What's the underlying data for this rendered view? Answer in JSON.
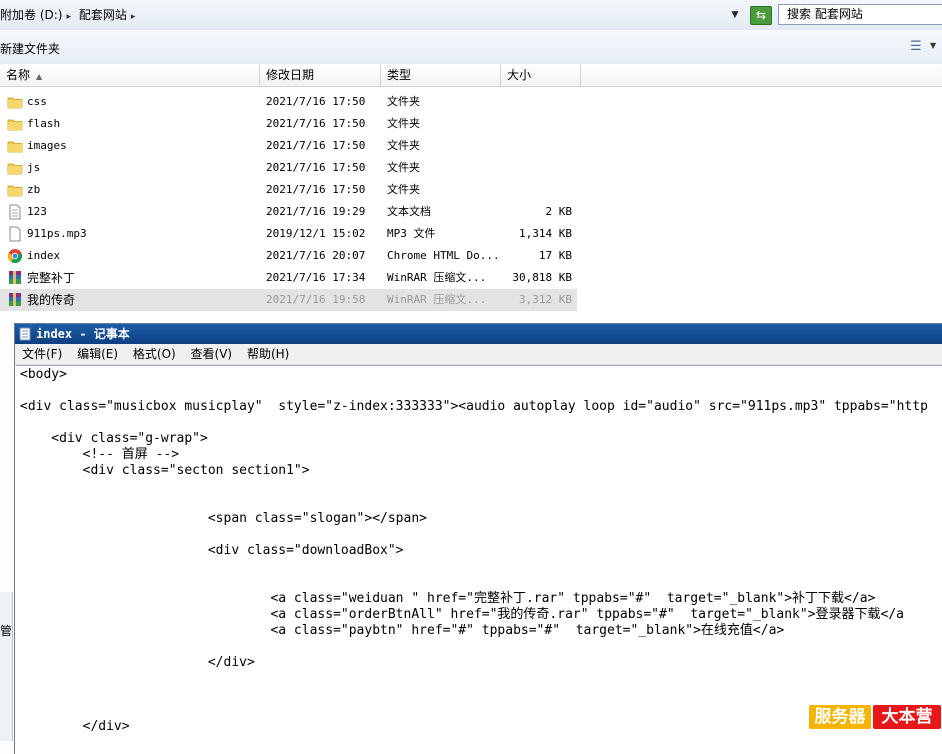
{
  "address_bar": {
    "crumbs": [
      "附加卷 (D:)",
      "配套网站"
    ],
    "search_placeholder": "搜索 配套网站"
  },
  "toolbar": {
    "new_folder": "新建文件夹"
  },
  "columns": {
    "name": "名称",
    "modified": "修改日期",
    "type": "类型",
    "size": "大小"
  },
  "files": [
    {
      "name": "css",
      "date": "2021/7/16 17:50",
      "type": "文件夹",
      "size": "",
      "icon": "folder-icon"
    },
    {
      "name": "flash",
      "date": "2021/7/16 17:50",
      "type": "文件夹",
      "size": "",
      "icon": "folder-icon"
    },
    {
      "name": "images",
      "date": "2021/7/16 17:50",
      "type": "文件夹",
      "size": "",
      "icon": "folder-icon"
    },
    {
      "name": "js",
      "date": "2021/7/16 17:50",
      "type": "文件夹",
      "size": "",
      "icon": "folder-icon"
    },
    {
      "name": "zb",
      "date": "2021/7/16 17:50",
      "type": "文件夹",
      "size": "",
      "icon": "folder-icon"
    },
    {
      "name": "123",
      "date": "2021/7/16 19:29",
      "type": "文本文档",
      "size": "2 KB",
      "icon": "text-file-icon"
    },
    {
      "name": "911ps.mp3",
      "date": "2019/12/1 15:02",
      "type": "MP3 文件",
      "size": "1,314 KB",
      "icon": "audio-file-icon"
    },
    {
      "name": "index",
      "date": "2021/7/16 20:07",
      "type": "Chrome HTML Do...",
      "size": "17 KB",
      "icon": "chrome-icon"
    },
    {
      "name": "完整补丁",
      "date": "2021/7/16 17:34",
      "type": "WinRAR 压缩文...",
      "size": "30,818 KB",
      "icon": "winrar-icon"
    },
    {
      "name": "我的传奇",
      "date": "2021/7/16 19:58",
      "type": "WinRAR 压缩文...",
      "size": "3,312 KB",
      "icon": "winrar-icon",
      "selected": true
    }
  ],
  "left_pane": {
    "partial_label": "管"
  },
  "notepad": {
    "title": "index - 记事本",
    "menu": [
      "文件(F)",
      "编辑(E)",
      "格式(O)",
      "查看(V)",
      "帮助(H)"
    ],
    "lines": [
      "<body>",
      "",
      "<div class=\"musicbox musicplay\"  style=\"z-index:333333\"><audio autoplay loop id=\"audio\" src=\"911ps.mp3\" tppabs=\"http",
      "",
      "    <div class=\"g-wrap\">",
      "        <!-- 首屏 -->",
      "        <div class=\"secton section1\">",
      "",
      "",
      "                        <span class=\"slogan\"></span>",
      "",
      "                        <div class=\"downloadBox\">",
      "",
      "",
      "                                <a class=\"weiduan \" href=\"完整补丁.rar\" tppabs=\"#\"  target=\"_blank\">补丁下载</a>",
      "                                <a class=\"orderBtnAll\" href=\"我的传奇.rar\" tppabs=\"#\"  target=\"_blank\">登录器下载</a",
      "                                <a class=\"paybtn\" href=\"#\" tppabs=\"#\"  target=\"_blank\">在线充值</a>",
      "",
      "                        </div>",
      "",
      "",
      "",
      "        </div>"
    ]
  },
  "watermark": {
    "part_a": "服务器",
    "part_b": "大本营"
  },
  "colors": {
    "title_bar": "#0d3f80",
    "selection": "#e3e3e3",
    "watermark_a": "#f5b400",
    "watermark_b": "#e8181a"
  }
}
